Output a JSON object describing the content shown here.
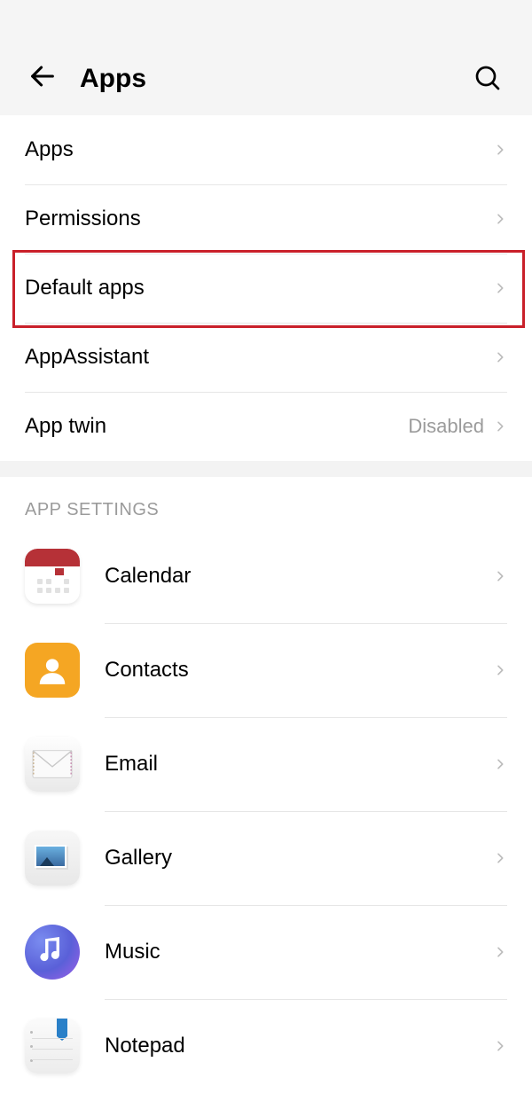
{
  "header": {
    "title": "Apps"
  },
  "main": {
    "items": [
      {
        "label": "Apps",
        "value": ""
      },
      {
        "label": "Permissions",
        "value": ""
      },
      {
        "label": "Default apps",
        "value": ""
      },
      {
        "label": "AppAssistant",
        "value": ""
      },
      {
        "label": "App twin",
        "value": "Disabled"
      }
    ]
  },
  "section_title": "APP SETTINGS",
  "apps": [
    {
      "label": "Calendar"
    },
    {
      "label": "Contacts"
    },
    {
      "label": "Email"
    },
    {
      "label": "Gallery"
    },
    {
      "label": "Music"
    },
    {
      "label": "Notepad"
    }
  ]
}
